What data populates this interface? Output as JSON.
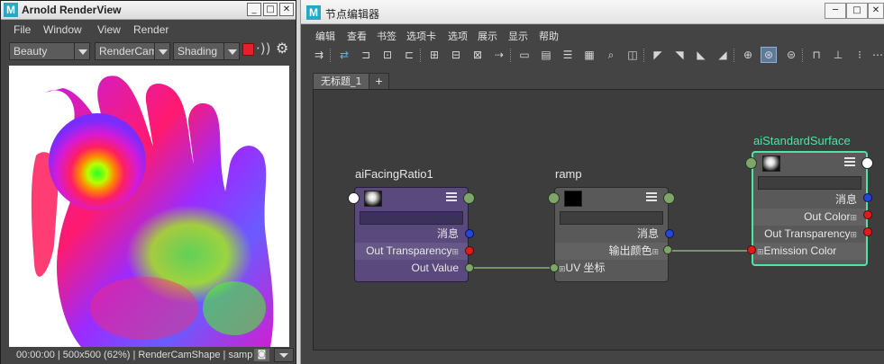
{
  "arnold": {
    "title": "Arnold RenderView",
    "menu": [
      "File",
      "Window",
      "View",
      "Render"
    ],
    "aov_select": "Beauty",
    "camera_select": "RenderCamS",
    "mode_select": "Shading",
    "status": "00:00:00 | 500x500 (62%) | RenderCamShape  | samp"
  },
  "node_editor": {
    "title": "节点编辑器",
    "menu": [
      "编辑",
      "查看",
      "书签",
      "选项卡",
      "选项",
      "展示",
      "显示",
      "帮助"
    ],
    "tabs": [
      "无标题_1",
      "+"
    ],
    "nodes": {
      "facing": {
        "name": "aiFacingRatio1",
        "attrs": [
          "消息",
          "Out Transparency",
          "Out Value"
        ]
      },
      "ramp": {
        "name": "ramp",
        "attrs": [
          "消息",
          "输出颜色",
          "UV 坐标"
        ]
      },
      "surface": {
        "name": "aiStandardSurface",
        "attrs": [
          "消息",
          "Out Color",
          "Out Transparency",
          "Emission Color"
        ]
      }
    }
  },
  "colors": {
    "accent_selected": "#4fe3a6",
    "facing_node": "#59497c",
    "plug_message": "#2347d9",
    "plug_color": "#e01b1b",
    "plug_float": "#7fa56c"
  }
}
